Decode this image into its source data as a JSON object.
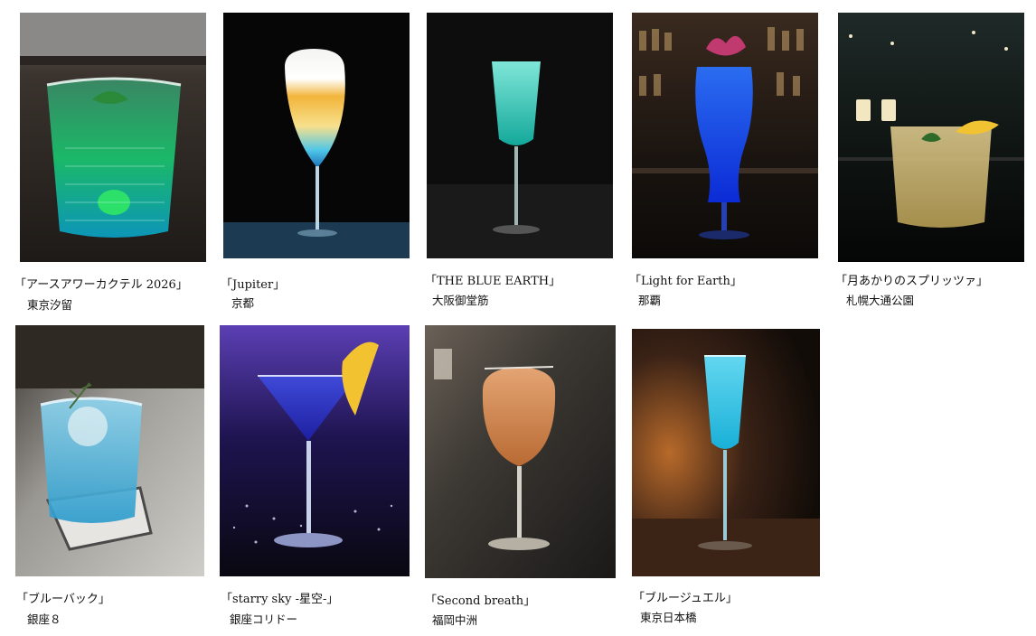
{
  "items": [
    {
      "title": "「アースアワーカクテル 2026」",
      "location": "東京汐留",
      "icon": "rocks-glass-green-cocktail"
    },
    {
      "title": "「Jupiter」",
      "location": "京都",
      "icon": "tulip-glass-layered-cocktail"
    },
    {
      "title": "「THE BLUE EARTH」",
      "location": "大阪御堂筋",
      "icon": "flute-glass-teal-cocktail"
    },
    {
      "title": "「Light for Earth」",
      "location": "那覇",
      "icon": "hurricane-glass-blue-cocktail"
    },
    {
      "title": "「月あかりのスプリッツァ」",
      "location": "札幌大通公園",
      "icon": "tumbler-glass-yellow-spritzer"
    },
    {
      "title": "「ブルーバック」",
      "location": "銀座８",
      "icon": "rocks-glass-light-blue-cocktail"
    },
    {
      "title": "「starry sky -星空-」",
      "location": "銀座コリドー",
      "icon": "martini-glass-blue-cocktail"
    },
    {
      "title": "「Second breath」",
      "location": "福岡中洲",
      "icon": "wine-glass-orange-cocktail"
    },
    {
      "title": "「ブルージュエル」",
      "location": "東京日本橋",
      "icon": "flute-glass-blue-sparkling"
    }
  ]
}
